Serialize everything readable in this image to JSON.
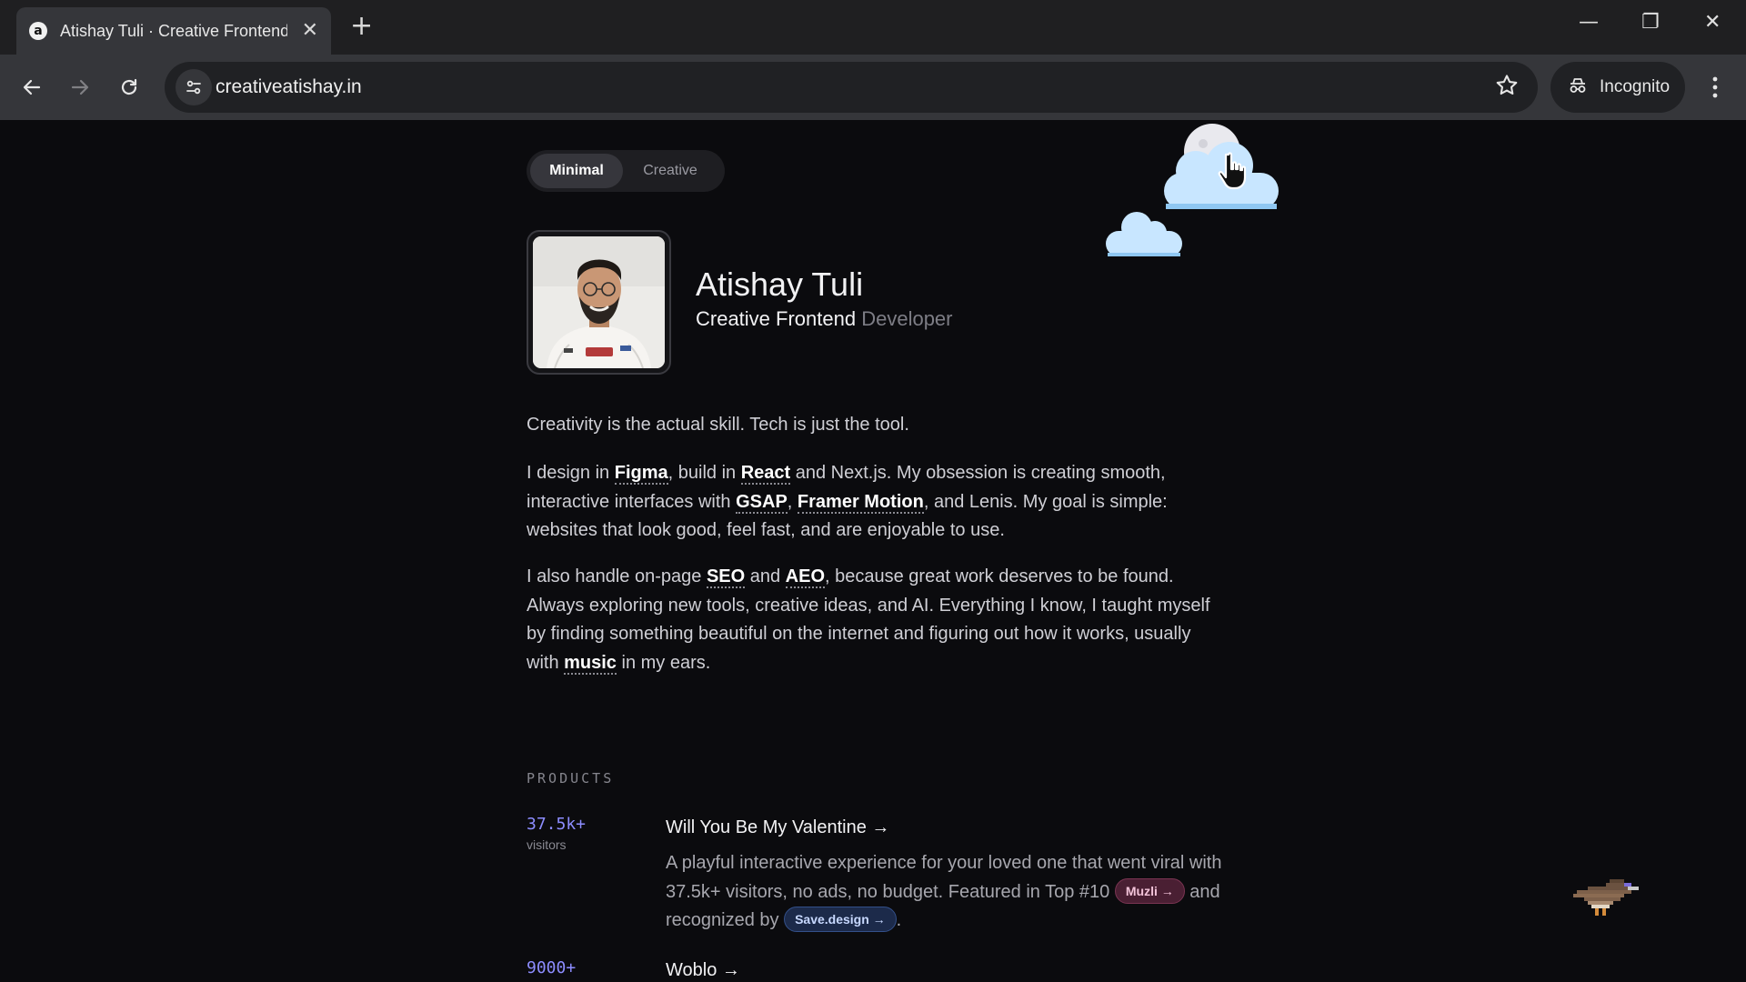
{
  "browser": {
    "tab_title": "Atishay Tuli · Creative Frontend",
    "favicon_letter": "a",
    "url": "creativeatishay.in",
    "incognito_label": "Incognito"
  },
  "icons": [
    "back-arrow-icon",
    "forward-arrow-icon",
    "reload-icon",
    "site-settings-icon",
    "bookmark-star-icon",
    "incognito-icon",
    "more-vert-icon",
    "moon-icon",
    "cloud-icon",
    "hand-cursor-icon",
    "pixel-bird-icon"
  ],
  "toggle": {
    "minimal": "Minimal",
    "creative": "Creative"
  },
  "profile": {
    "name": "Atishay Tuli",
    "role_main": "Creative Frontend",
    "role_dim": "Developer"
  },
  "intro": {
    "line1": "Creativity is the actual skill. Tech is just the tool.",
    "p2": {
      "t1": "I design in ",
      "figma": "Figma",
      "t2": ", build in ",
      "react": "React",
      "t3": " and Next.js. My obsession is creating smooth, interactive interfaces with ",
      "gsap": "GSAP",
      "t4": ", ",
      "framer": "Framer Motion",
      "t5": ", and Lenis. My goal is simple: websites that look good, feel fast, and are enjoyable to use."
    },
    "p3": {
      "t1": "I also handle on-page ",
      "seo": "SEO",
      "t2": " and ",
      "aeo": "AEO",
      "t3": ", because great work deserves to be found. Always exploring new tools, creative ideas, and AI. Everything I know, I taught myself by finding something beautiful on the internet and figuring out how it works, usually with ",
      "music": "music",
      "t4": " in my ears."
    }
  },
  "products": {
    "label": "PRODUCTS",
    "items": [
      {
        "stat": "37.5k+",
        "stat_label": "visitors",
        "title": "Will You Be My Valentine →",
        "desc_1": "A playful interactive experience for your loved one that went viral with 37.5k+ visitors, no ads, no budget. Featured in Top #10 ",
        "chip_1": "Muzli →",
        "desc_2": " and recognized by ",
        "chip_2": "Save.design →",
        "desc_3": "."
      },
      {
        "stat": "9000+",
        "title": "Woblo →"
      }
    ]
  },
  "colors": {
    "accent": "#8d8dff",
    "background": "#0b0b0e",
    "chip_pink": "#4a1f33",
    "chip_blue": "#1c2a4a"
  }
}
